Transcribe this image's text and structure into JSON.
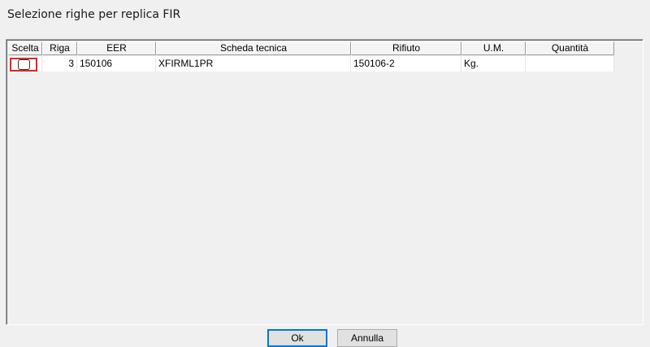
{
  "dialog": {
    "title": "Selezione righe per replica FIR"
  },
  "table": {
    "columns": [
      "Scelta",
      "Riga",
      "EER",
      "Scheda tecnica",
      "Rifiuto",
      "U.M.",
      "Quantità"
    ],
    "rows": [
      {
        "scelta": "",
        "riga": "3",
        "eer": "150106",
        "scheda": "XFIRML1PR",
        "rifiuto": "150106-2",
        "um": "Kg.",
        "quantita": ""
      }
    ],
    "highlight_color": "#e0262a"
  },
  "buttons": {
    "ok": "Ok",
    "cancel": "Annulla"
  }
}
